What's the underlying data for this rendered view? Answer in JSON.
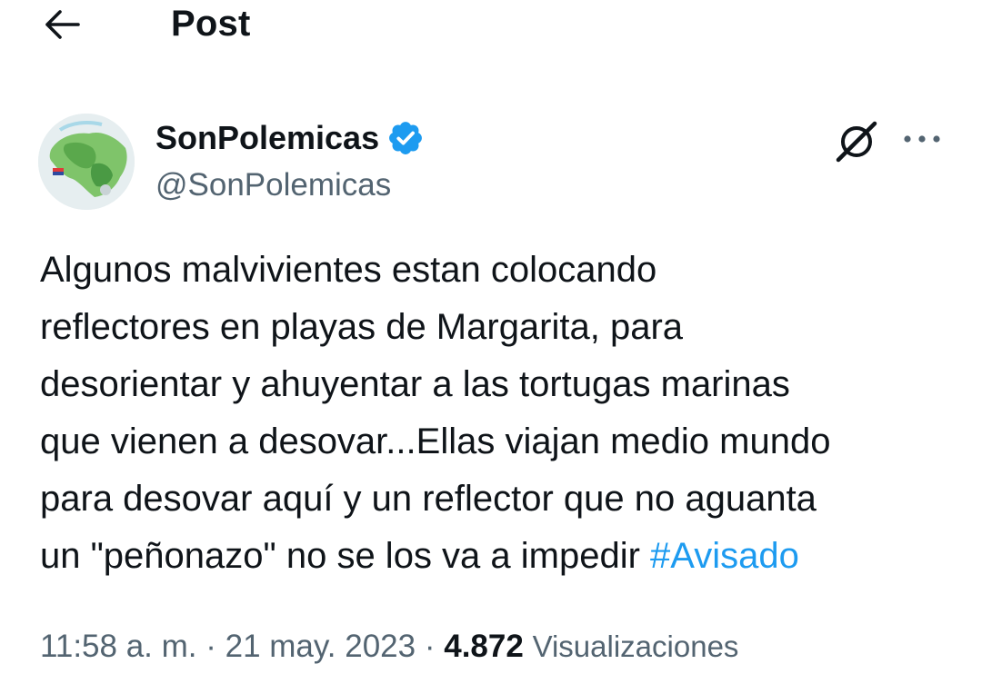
{
  "header": {
    "back_icon": "arrow-left-icon",
    "title": "Post"
  },
  "author": {
    "avatar": "map-avatar",
    "display_name": "SonPolemicas",
    "verified_icon": "verified-badge-icon",
    "verified_color": "#1d9bf0",
    "handle": "@SonPolemicas"
  },
  "actions": {
    "grok_icon": "grok-icon",
    "more_icon": "more-horizontal-icon"
  },
  "tweet": {
    "lines": [
      "Algunos malvivientes estan colocando",
      "reflectores en playas de Margarita, para",
      "desorientar y ahuyentar a las tortugas marinas",
      "que vienen a desovar...Ellas viajan medio mundo",
      "para desovar aquí y un reflector que no aguanta",
      "un \"peñonazo\" no se los va a impedir "
    ],
    "hashtag": "#Avisado",
    "hashtag_color": "#1d9bf0"
  },
  "meta": {
    "time": "11:58 a. m.",
    "separator": " · ",
    "date": "21 may. 2023",
    "views_count": "4.872",
    "views_label": "Visualizaciones"
  }
}
